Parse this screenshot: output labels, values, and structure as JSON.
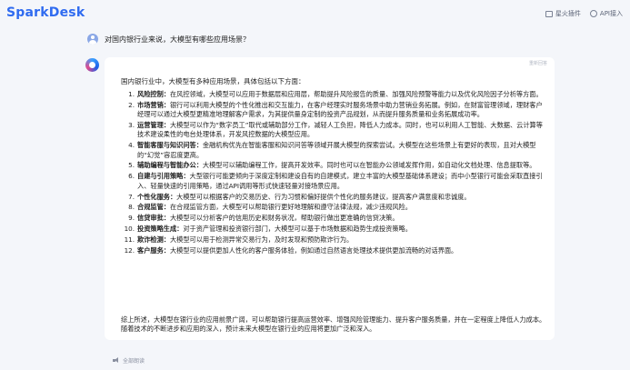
{
  "app": {
    "logo": "SparkDesk",
    "actions": [
      {
        "label": "星火插件",
        "icon": "plugin-icon"
      },
      {
        "label": "API接入",
        "icon": "api-icon"
      }
    ]
  },
  "question": {
    "text": "对国内银行业来说，大模型有哪些应用场景？"
  },
  "answer": {
    "top_label": "重新回答",
    "intro": "国内银行业中，大模型有多种应用场景，具体包括以下方面：",
    "items": [
      {
        "num": "1.",
        "title": "风险控制：",
        "text": "在风控领域，大模型可以应用于数据层和应用层，帮助提升风险报告的质量、加强风险预警等能力以及优化风险因子分析等方面。"
      },
      {
        "num": "2.",
        "title": "市场营销：",
        "text": "银行可以利用大模型的个性化推出和交互能力，在客户经理实时服务场景中助力营销业务拓展。例如，在财富管理领域，理财客户经理可以通过大模型更精准地理解客户需求，为其提供量身定制的投资产品规划，从而提升服务质量和业务拓展成功率。"
      },
      {
        "num": "3.",
        "title": "运营管理：",
        "text": "大模型可以作为“数字员工”取代或辅助部分工作，减轻人工负担，降低人力成本。同时，也可以利用人工智能、大数据、云计算等技术建设柔性的电台处理体系，开发风控数据的大模型应用。"
      },
      {
        "num": "4.",
        "title": "智能客服与知识问答：",
        "text": "金融机构优先在智能客服和知识问答等领域开展大模型的探索尝试。大模型在这些场景上有更好的表现，且对大模型的“幻觉”容忍度更高。"
      },
      {
        "num": "5.",
        "title": "辅助编程与智能办公：",
        "text": "大模型可以辅助编程工作，提高开发效率。同时也可以在智能办公领域发挥作用，如自动化文档处理、信息提取等。"
      },
      {
        "num": "6.",
        "title": "自建与引用策略：",
        "text": "大型银行可能更倾向于深度定制和建设自有的自建模式，建立丰富的大模型基础体系建设；而中小型银行可能会采取直接引入、轻量快速的引用策略，通过API调用等形式快速轻量对接场景应用。"
      },
      {
        "num": "7.",
        "title": "个性化服务：",
        "text": "大模型可以根据客户的交易历史、行为习惯和偏好提供个性化的服务建议，提高客户满意度和忠诚度。"
      },
      {
        "num": "8.",
        "title": "合规监管：",
        "text": "在合规监管方面，大模型可以帮助银行更好地理解和遵守法律法规，减少违规风险。"
      },
      {
        "num": "9.",
        "title": "信贷审批：",
        "text": "大模型可以分析客户的信用历史和财务状况，帮助银行做出更准确的信贷决策。"
      },
      {
        "num": "10.",
        "title": "投资策略生成：",
        "text": "对于资产管理和投资银行部门，大模型可以基于市场数据和趋势生成投资策略。"
      },
      {
        "num": "11.",
        "title": "欺诈检测：",
        "text": "大模型可以用于检测异常交易行为，及时发现和预防欺诈行为。"
      },
      {
        "num": "12.",
        "title": "客户服务：",
        "text": "大模型可以提供更加人性化的客户服务体验，例如通过自然语言处理技术提供更加流畅的对话界面。"
      }
    ],
    "summary": "综上所述，大模型在银行业的应用前景广阔，可以帮助银行提高运营效率、增强风险管理能力、提升客户服务质量，并在一定程度上降低人力成本。随着技术的不断进步和应用的深入，预计未来大模型在银行业的应用将更加广泛和深入。"
  },
  "footer": {
    "read_label": "全部朗读"
  }
}
